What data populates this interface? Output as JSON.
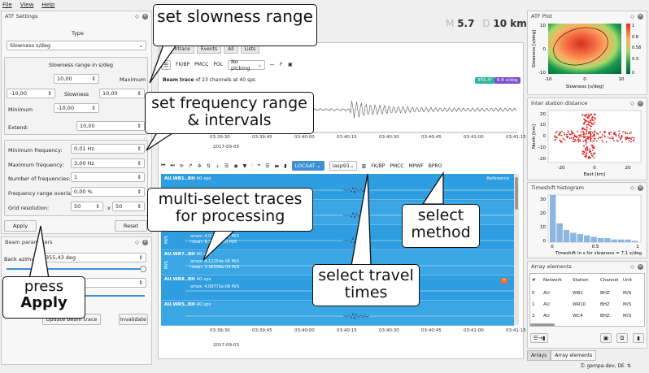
{
  "menu": {
    "file": "File",
    "view": "View",
    "help": "Help"
  },
  "atf": {
    "title": "ATF Settings",
    "type_label": "Type",
    "type_value": "Slowness s/deg",
    "range_label": "Slowness range in s/deg",
    "maximum_label": "Maximum",
    "maximum_value": "10,00",
    "center_x": "-10,00",
    "slowness_label": "Slowness",
    "slowness_value": "10,00",
    "minimum_label": "Minimum",
    "minimum_value": "-10,00",
    "extend_label": "Extend:",
    "extend_value": "10,00",
    "min_freq_label": "Minimum frequency:",
    "min_freq_value": "0,01 Hz",
    "max_freq_label": "Maximum frequency:",
    "max_freq_value": "3,00 Hz",
    "num_freq_label": "Number of frequencies:",
    "num_freq_value": "1",
    "overlap_label": "Frequency range overlap:",
    "overlap_value": "0,00 %",
    "grid_label": "Grid resolution:",
    "grid_x": "50",
    "grid_times": "x",
    "grid_y": "50",
    "apply": "Apply",
    "reset": "Reset"
  },
  "beam": {
    "title": "Beam parameters",
    "back_azimuth_label": "Back azimuth:",
    "back_azimuth_value": "355,43 deg",
    "update": "Update beam trace",
    "invalidate": "Invalidate"
  },
  "magnitude": {
    "m_label": "M",
    "m_value": "5.7",
    "d_label": "D",
    "d_value": "10 km"
  },
  "toolbar1": {
    "fkbp": "FK/BP",
    "pmcc": "PMCC",
    "pol": "POL",
    "picking": "No picking"
  },
  "tabs": {
    "t1": "Beamtrace",
    "t2": "Events",
    "t3": "All",
    "t4": "Lists"
  },
  "beamtrace": {
    "title_bold": "Beam trace",
    "title_rest": " of 23 channels at 40 sps",
    "badge_az": "355.4°",
    "badge_slow": "6.8 s/deg",
    "ticks": [
      "03:39:30",
      "03:39:45",
      "03:40:00",
      "03:40:15",
      "03:40:30",
      "03:40:45",
      "03:41:00",
      "03:41:15"
    ],
    "date": "2017-09-03"
  },
  "toolbar2": {
    "locsat": "LOCSAT",
    "iasp": "iasp91",
    "fkbp": "FK/BP",
    "pmcc": "PMCC",
    "mpwf": "MPWF",
    "bpro": "BPRO"
  },
  "traces": [
    {
      "name": "AU.WB1..BH",
      "sps": "40 sps",
      "extra": "Reference",
      "unit": "",
      "amax": "",
      "mean": ""
    },
    {
      "name": "AU.WR10..BH",
      "sps": "40 sps",
      "extra": "",
      "unit": "",
      "amax": "",
      "mean": ""
    },
    {
      "name": "AU.WR5..BH",
      "sps": "40 sps",
      "extra": "",
      "unit": "M/S",
      "amax": "amax: 4.07313e-06 M/S",
      "mean": "mean: 6.3755e-10 M/S"
    },
    {
      "name": "AU.WR7..BH",
      "sps": "40 sps",
      "extra": "",
      "unit": "M/S",
      "amax": "amax: 4.12254e-06 M/S",
      "mean": "mean: 3.36596e-09 M/S"
    },
    {
      "name": "AU.WR8..BH",
      "sps": "40 sps",
      "extra": "",
      "unit": "",
      "amax": "amax: 4.09771e-06 M/S",
      "mean": ""
    },
    {
      "name": "AU.WR5..BH",
      "sps": "40 sps",
      "extra": "",
      "unit": "",
      "amax": "",
      "mean": ""
    }
  ],
  "bottom_axis": {
    "ticks": [
      "03:39:30",
      "03:39:45",
      "03:40:00",
      "03:40:15",
      "03:40:30",
      "03:40:45",
      "03:41:00",
      "03:41:15"
    ],
    "date": "2017-09-03"
  },
  "atf_plot": {
    "title": "ATF Plot",
    "ylabel": "Slowness [s/deg]",
    "xlabel": "Slowness [s/deg]",
    "yticks": [
      "10",
      "0",
      "-10"
    ],
    "xticks": [
      "-10",
      "0",
      "10"
    ],
    "cbar": [
      "1",
      "0.8",
      "0.58",
      "0.3",
      "0"
    ]
  },
  "inter_station": {
    "title": "Inter station distance",
    "ylabel": "North [km]",
    "xlabel": "East [km]",
    "yticks": [
      "20",
      "10",
      "0",
      "-10",
      "-20"
    ],
    "xticks": [
      "-20",
      "0",
      "20"
    ]
  },
  "timeshift": {
    "title": "Timeshift histogram",
    "xlabel": "Timeshift in s for slowness = 7.1 s/deg",
    "yticks": [
      "30",
      "20",
      "10",
      "0"
    ],
    "xticks": [
      "0",
      "0.5",
      "1"
    ],
    "chart_data": {
      "type": "bar",
      "values": [
        35,
        14,
        9,
        7,
        6,
        5,
        4,
        3,
        3,
        2,
        2,
        2,
        1
      ],
      "ylim": [
        0,
        35
      ]
    }
  },
  "array": {
    "title": "Array elements",
    "headers": [
      "#",
      "Network",
      "Station",
      "Channel",
      "Unit"
    ],
    "rows": [
      [
        "0",
        "AU",
        "WB1",
        "BHZ",
        "M/S"
      ],
      [
        "1",
        "AU",
        "WR10",
        "BHZ",
        "M/S"
      ],
      [
        "2",
        "AU",
        "WC4",
        "BHZ",
        "M/S"
      ]
    ]
  },
  "bottom_tabs": {
    "arrays": "Arrays",
    "elements": "Array elements"
  },
  "status": {
    "user": "gempa-dev, DE"
  },
  "callouts": {
    "c1": "set slowness range",
    "c2": "set frequency range & intervals",
    "c3": "multi-select traces for processing",
    "c4": "select method",
    "c5": "select travel times",
    "c6_line1": "press",
    "c6_line2": "Apply"
  },
  "colors": {
    "trace_blue": "#2f9ee0",
    "badge_az": "#2bb59a",
    "badge_slow": "#7a4fcf"
  }
}
